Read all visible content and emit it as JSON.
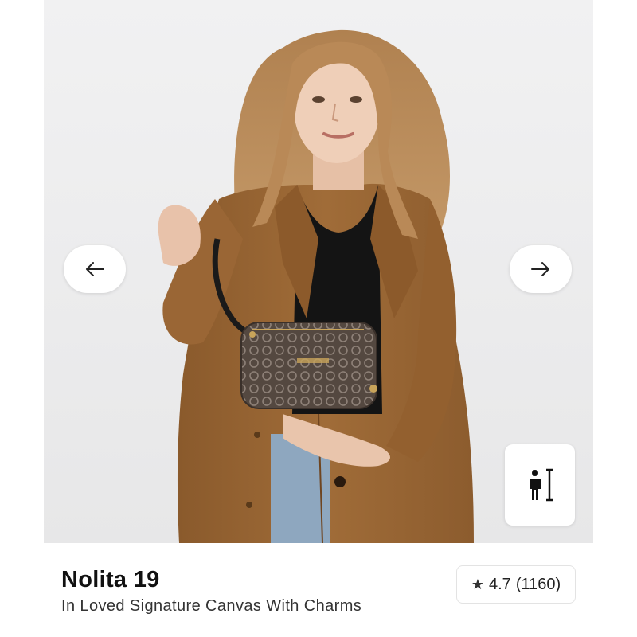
{
  "gallery": {
    "image_alt": "Model wearing a tan suede coat holding a signature canvas wristlet",
    "prev_icon": "arrow-left-icon",
    "next_icon": "arrow-right-icon",
    "fit_icon": "size-guide-person-icon"
  },
  "product": {
    "name": "Nolita 19",
    "subtitle": "In Loved Signature Canvas With Charms",
    "rating": {
      "star_icon": "★",
      "score": "4.7",
      "count": "(1160)"
    }
  },
  "colors": {
    "background": "#ececed",
    "coat": "#9a6734",
    "bag": "#5a4e46",
    "text": "#111111"
  }
}
